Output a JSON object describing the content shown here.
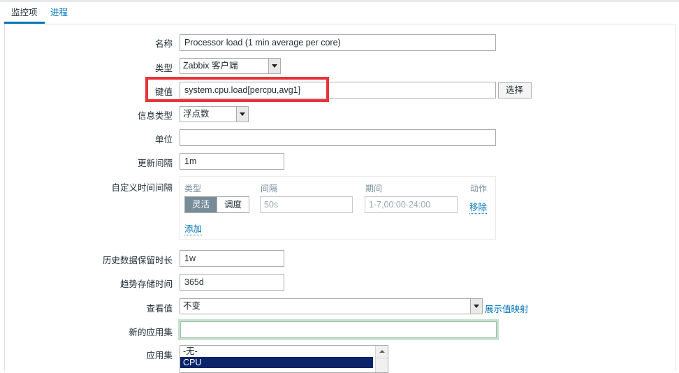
{
  "tabs": [
    {
      "label": "监控项"
    },
    {
      "label": "进程"
    }
  ],
  "form": {
    "name": {
      "label": "名称",
      "value": "Processor load (1 min average per core)"
    },
    "type": {
      "label": "类型",
      "value": "Zabbix 客户端"
    },
    "key": {
      "label": "键值",
      "value": "system.cpu.load[percpu,avg1]",
      "select_button": "选择"
    },
    "info_type": {
      "label": "信息类型",
      "value": "浮点数"
    },
    "units": {
      "label": "单位",
      "value": ""
    },
    "update_interval": {
      "label": "更新间隔",
      "value": "1m"
    },
    "custom_intervals": {
      "label": "自定义时间间隔",
      "headers": {
        "type": "类型",
        "interval": "间隔",
        "period": "期间",
        "action": "动作"
      },
      "type_options": [
        "灵活",
        "调度"
      ],
      "active_type": "灵活",
      "interval_placeholder": "50s",
      "period_placeholder": "1-7,00:00-24:00",
      "remove_link": "移除",
      "add_link": "添加"
    },
    "history": {
      "label": "历史数据保留时长",
      "value": "1w"
    },
    "trends": {
      "label": "趋势存储时间",
      "value": "365d"
    },
    "show_value": {
      "label": "查看值",
      "value": "不变",
      "mapping_link": "展示值映射"
    },
    "new_application": {
      "label": "新的应用集",
      "value": ""
    },
    "applications": {
      "label": "应用集",
      "options": [
        "-无-",
        "CPU"
      ],
      "selected": "CPU"
    }
  },
  "colors": {
    "accent": "#0275b8",
    "highlight_box": "#e8333a",
    "selected_option": "#0a246a"
  }
}
